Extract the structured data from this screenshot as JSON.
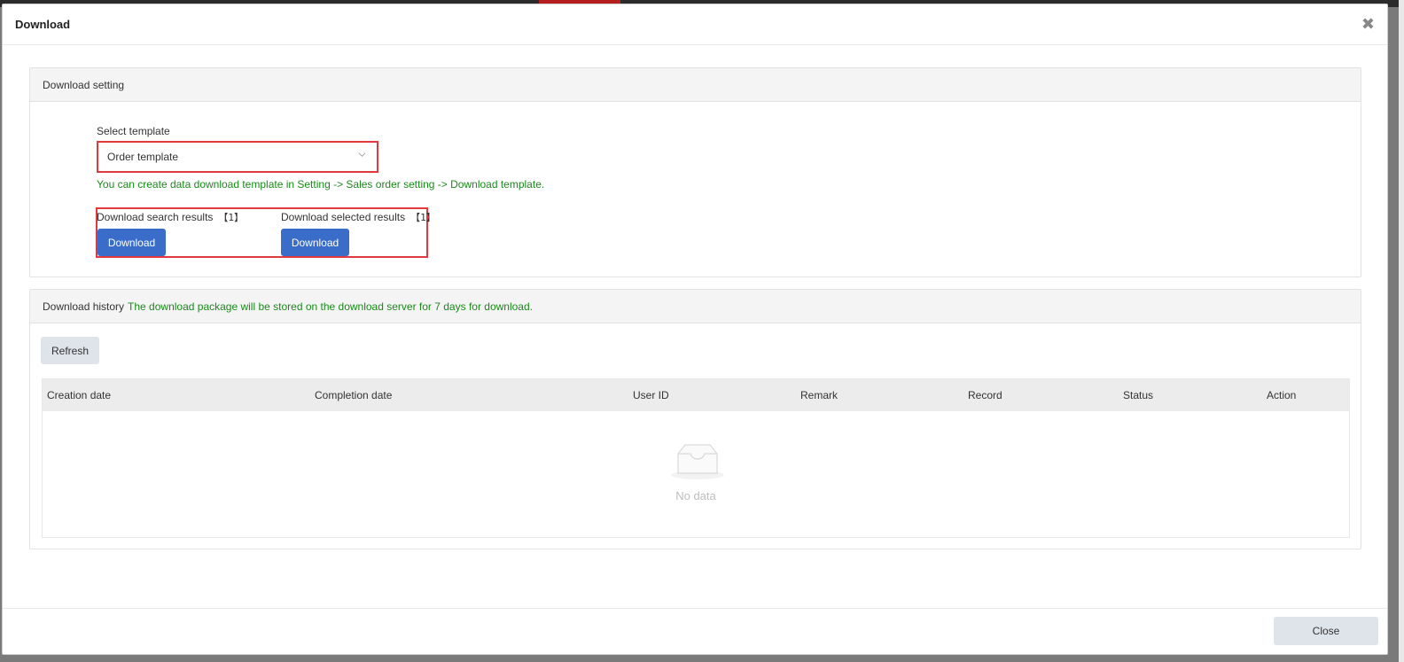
{
  "dialog": {
    "title": "Download",
    "close_glyph": "✖"
  },
  "download_setting": {
    "header": "Download setting",
    "select_label": "Select template",
    "selected_template": "Order template",
    "hint": "You can create data download template in Setting -> Sales order setting -> Download template.",
    "search_results_label": "Download search results",
    "search_results_count": "【1】",
    "selected_results_label": "Download selected results",
    "selected_results_count": "【1】",
    "download_button": "Download"
  },
  "download_history": {
    "header": "Download history",
    "note": "The download package will be stored on the download server for 7 days for download.",
    "refresh_button": "Refresh",
    "columns": [
      "Creation date",
      "Completion date",
      "User ID",
      "Remark",
      "Record",
      "Status",
      "Action"
    ],
    "empty_text": "No data"
  },
  "footer": {
    "close_button": "Close"
  },
  "colors": {
    "primary": "#3a6dc9",
    "highlight_border": "#e0393e",
    "hint_green": "#1a8a1a"
  },
  "icons": [
    "close-icon",
    "chevron-down-icon",
    "empty-inbox-icon"
  ]
}
